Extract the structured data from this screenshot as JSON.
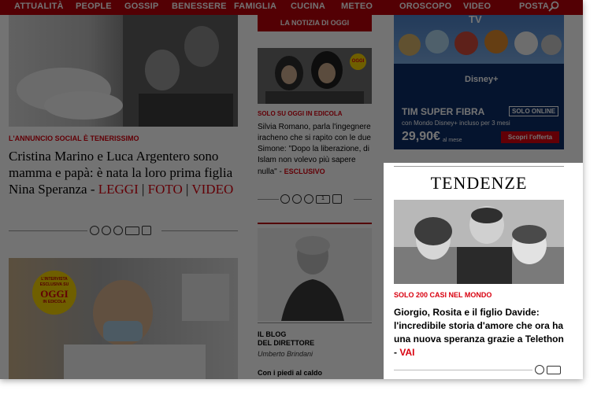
{
  "nav": {
    "items": [
      "ATTUALITÀ",
      "PEOPLE",
      "GOSSIP",
      "BENESSERE",
      "FAMIGLIA",
      "CUCINA",
      "METEO",
      "OROSCOPO",
      "VIDEO",
      "POSTA"
    ],
    "search_icon": "search-icon"
  },
  "left": {
    "kicker": "L'ANNUNCIO SOCIAL È TENERISSIMO",
    "title": "Cristina Marino e Luca Argentero sono mamma e papà: è nata la loro prima figlia Nina Speranza -",
    "link_leggi": "LEGGI",
    "sep1": "|",
    "link_foto": "FOTO",
    "sep2": "|",
    "link_video": "VIDEO",
    "badge_line1": "L'INTERVISTA",
    "badge_line2": "ESCLUSIVA SU",
    "badge_logo": "OGGI",
    "badge_line3": "IN EDICOLA"
  },
  "middle": {
    "header": "LA NOTIZIA DI OGGI",
    "kicker": "SOLO SU OGGI IN EDICOLA",
    "text": "Silvia Romano, parla l'ingegnere iracheno che si rapito con le due Simone: \"Dopo la liberazione, di Islam non volevo più sapere nulla\" -",
    "link": "ESCLUSIVO",
    "count": "1",
    "blog_label_1": "IL BLOG",
    "blog_label_2": "DEL DIRETTORE",
    "author": "Umberto Brindani",
    "post_title": "Con i piedi al caldo",
    "mini_logo": "OGGI"
  },
  "ad": {
    "tv_label": "TV",
    "disney": "Disney+",
    "brand": "TIM SUPER FIBRA",
    "online": "SOLO ONLINE",
    "sub": "con Mondo Disney+ incluso per 3 mesi",
    "price": "29,90€",
    "price_suffix": "al mese",
    "cta": "Scopri l'offerta"
  },
  "tendenze": {
    "title": "TENDENZE",
    "kicker": "SOLO 200 CASI NEL MONDO",
    "headline": "Giorgio, Rosita e il figlio Davide: l'incredibile storia d'amore che ora ha una nuova speranza grazie a Telethon -",
    "link": "VAI"
  },
  "colors": {
    "brand_red": "#d9000f",
    "nav_red": "#b8000b",
    "overlay": "rgba(0,0,0,0.55)"
  }
}
